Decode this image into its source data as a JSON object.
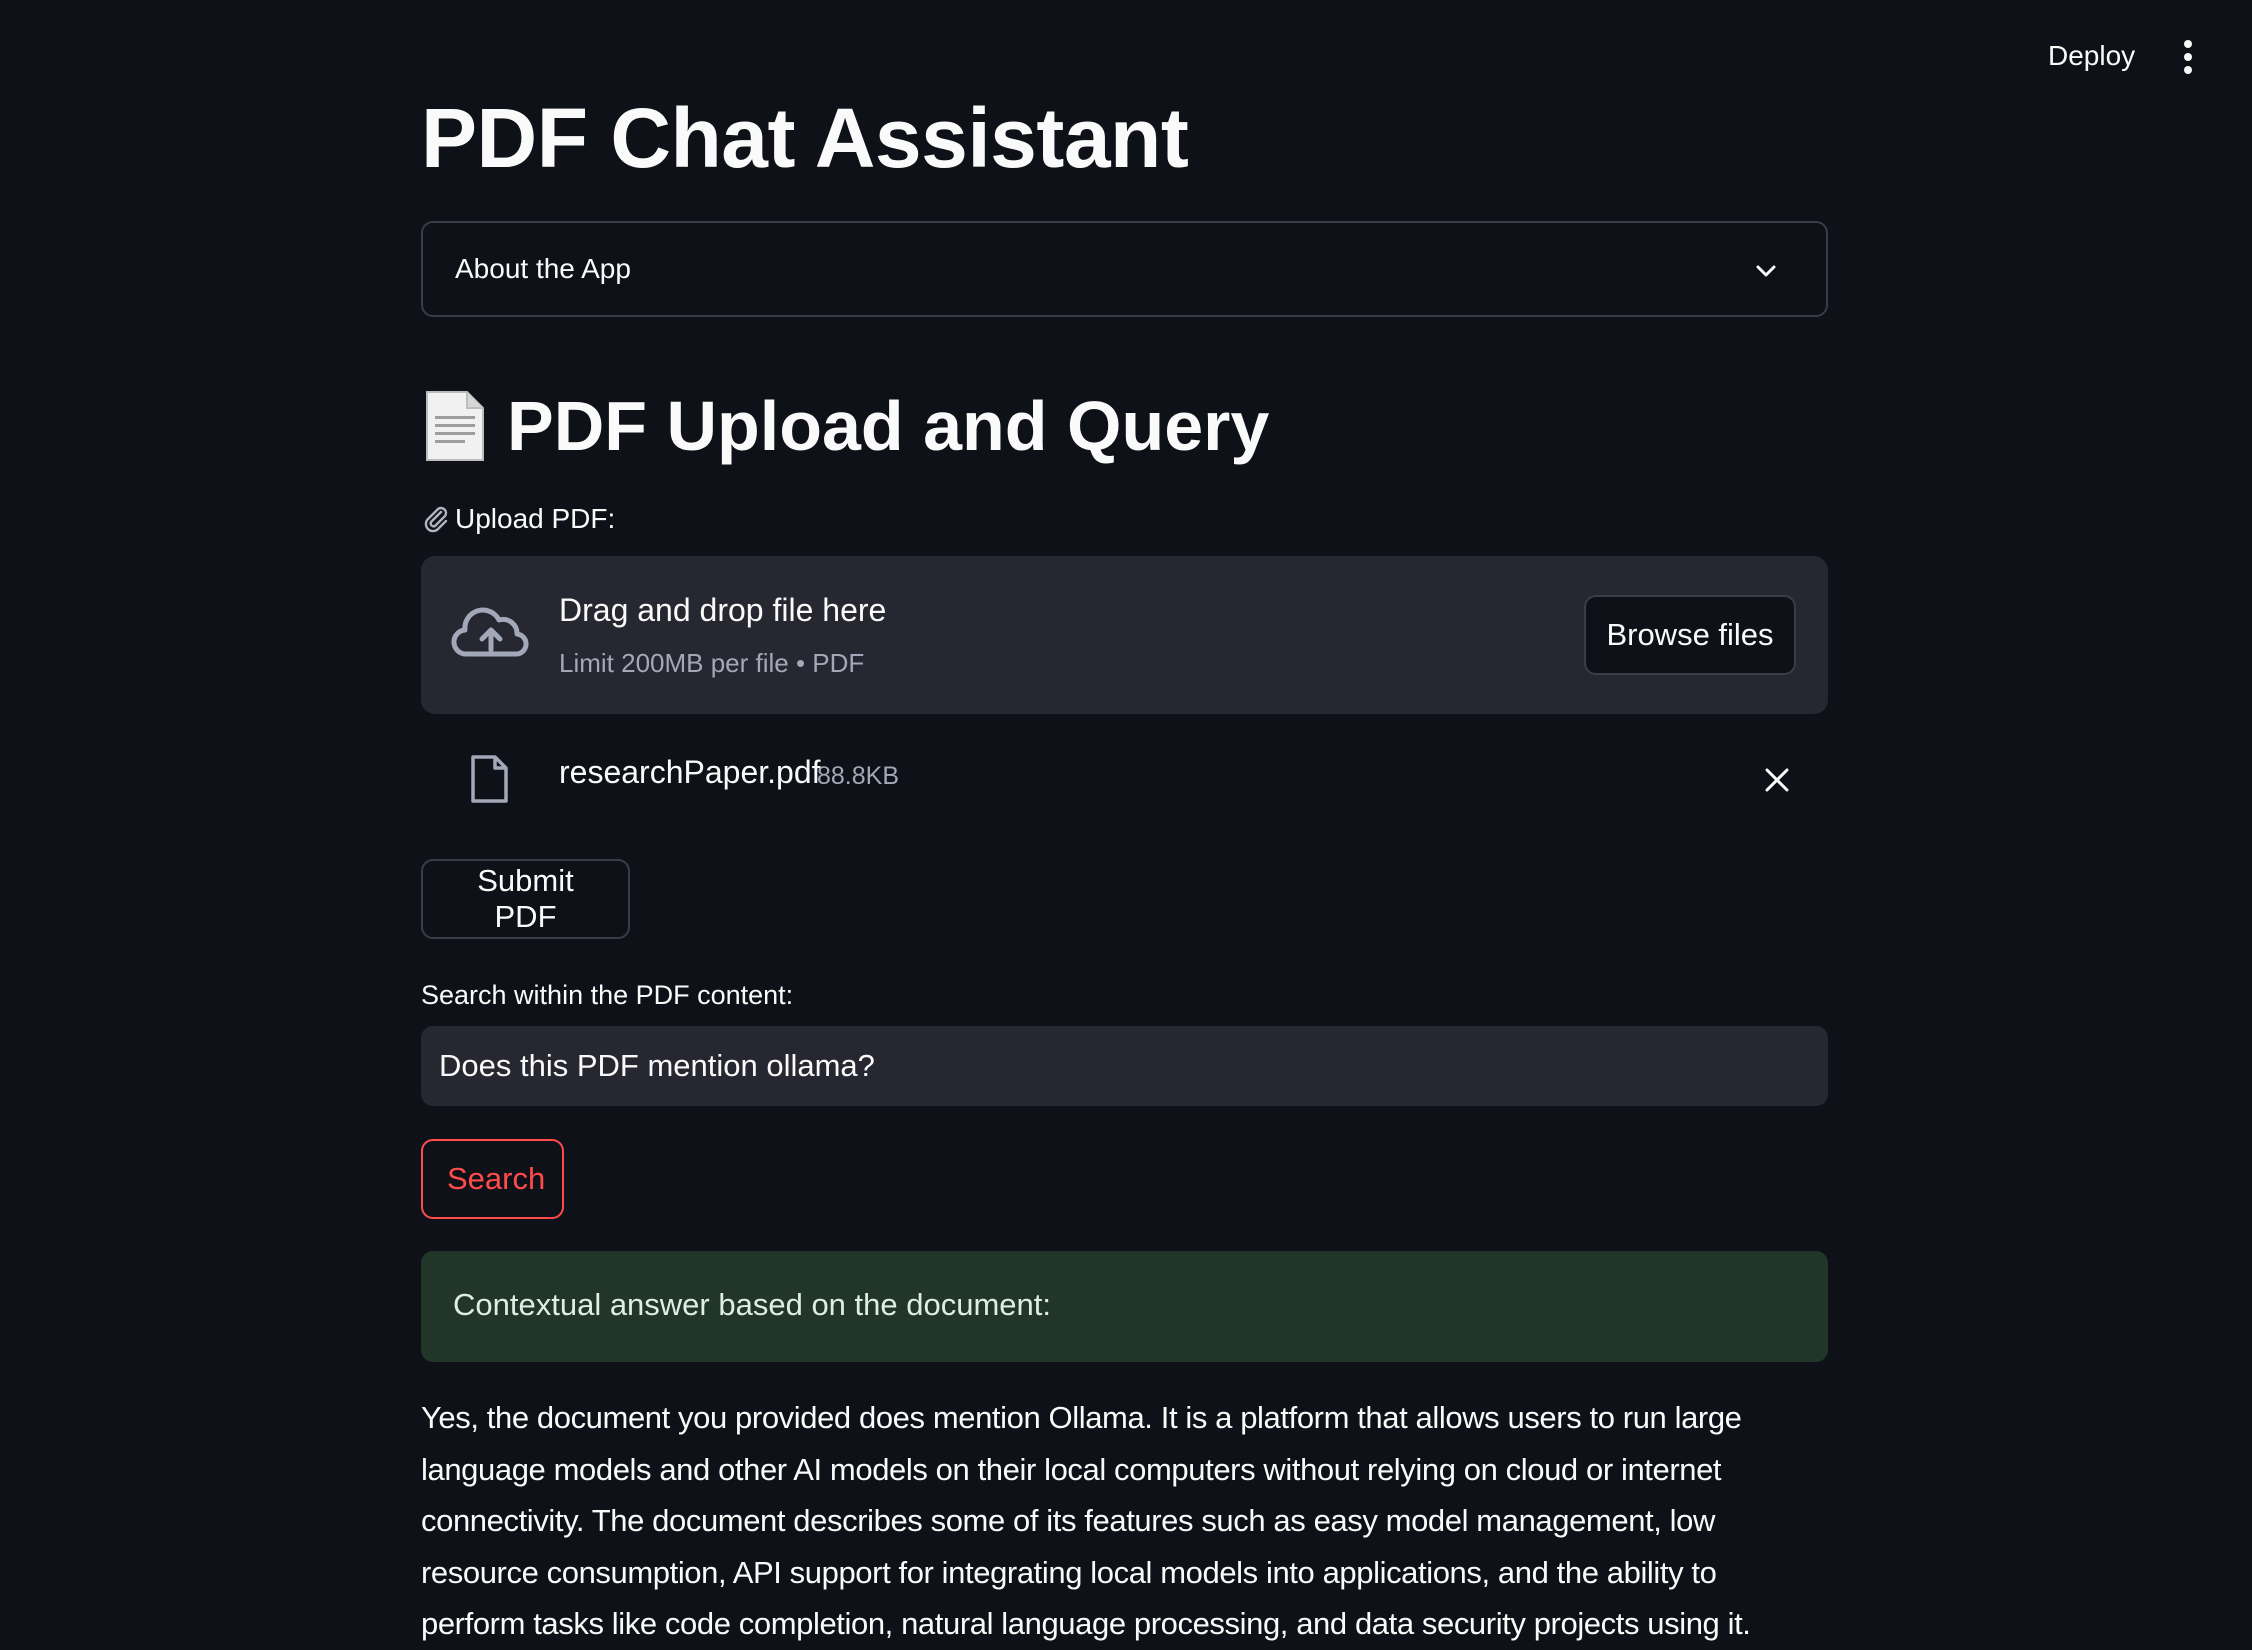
{
  "header": {
    "deploy_label": "Deploy",
    "menu_icon": "kebab-menu-icon"
  },
  "main": {
    "title": "PDF Chat Assistant",
    "expander": {
      "label": "About the App",
      "icon": "chevron-down-icon"
    },
    "section": {
      "icon": "page-facing-up-icon",
      "heading": "PDF Upload and Query"
    },
    "upload": {
      "label": "Upload PDF:",
      "label_icon": "paperclip-icon",
      "dropzone_title": "Drag and drop file here",
      "dropzone_subtitle": "Limit 200MB per file • PDF",
      "browse_label": "Browse files",
      "file": {
        "name": "researchPaper.pdf",
        "size": "88.8KB"
      }
    },
    "submit_label": "Submit PDF",
    "search": {
      "label": "Search within the PDF content:",
      "value": "Does this PDF mention ollama?",
      "button_label": "Search"
    },
    "result": {
      "banner": "Contextual answer based on the document:",
      "answer": "Yes, the document you provided does mention Ollama. It is a platform that allows users to run large language models and other AI models on their local computers without relying on cloud or internet connectivity. The document describes some of its features such as easy model management, low resource consumption, API support for integrating local models into applications, and the ability to perform tasks like code completion, natural language processing, and data security projects using it."
    }
  },
  "colors": {
    "background": "#0e1117",
    "surface": "#262730",
    "border": "#3a3d45",
    "accent": "#ff4b4b",
    "success_bg": "#213529",
    "muted_text": "#a3a8b8"
  }
}
